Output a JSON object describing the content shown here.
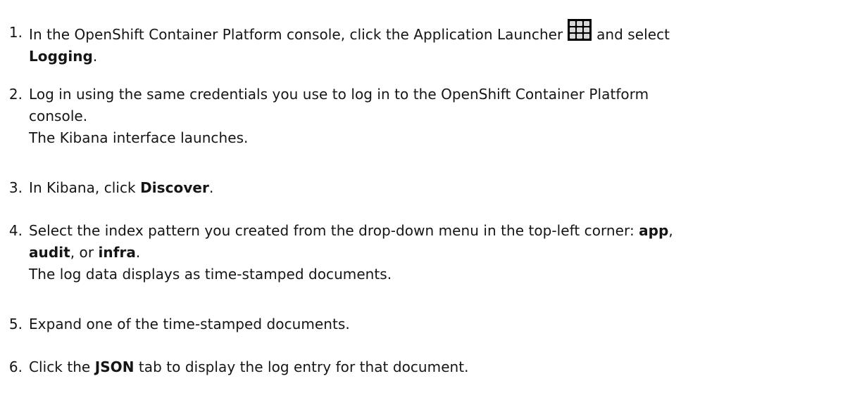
{
  "steps": [
    {
      "number": "1.",
      "text_before_icon": "In the OpenShift Container Platform console, click the Application Launcher ",
      "icon": "application-launcher-grid-icon",
      "text_after_icon": " and select",
      "bold_1": "Logging",
      "tail": "."
    },
    {
      "number": "2.",
      "line1": "Log in using the same credentials you use to log in to the OpenShift Container Platform",
      "line2": "console.",
      "line3": "The Kibana interface launches."
    },
    {
      "number": "3.",
      "text_before": "In Kibana, click ",
      "bold_1": "Discover",
      "tail": "."
    },
    {
      "number": "4.",
      "line1_before": "Select the index pattern you created from the drop-down menu in the top-left corner: ",
      "bold_app": "app",
      "comma": ",",
      "bold_audit": "audit",
      "or_text": ", or ",
      "bold_infra": "infra",
      "tail": ".",
      "line3": "The log data displays as time-stamped documents."
    },
    {
      "number": "5.",
      "text": "Expand one of the time-stamped documents."
    },
    {
      "number": "6.",
      "text_before": "Click the ",
      "bold_1": "JSON",
      "text_after": " tab to display the log entry for that document."
    }
  ]
}
